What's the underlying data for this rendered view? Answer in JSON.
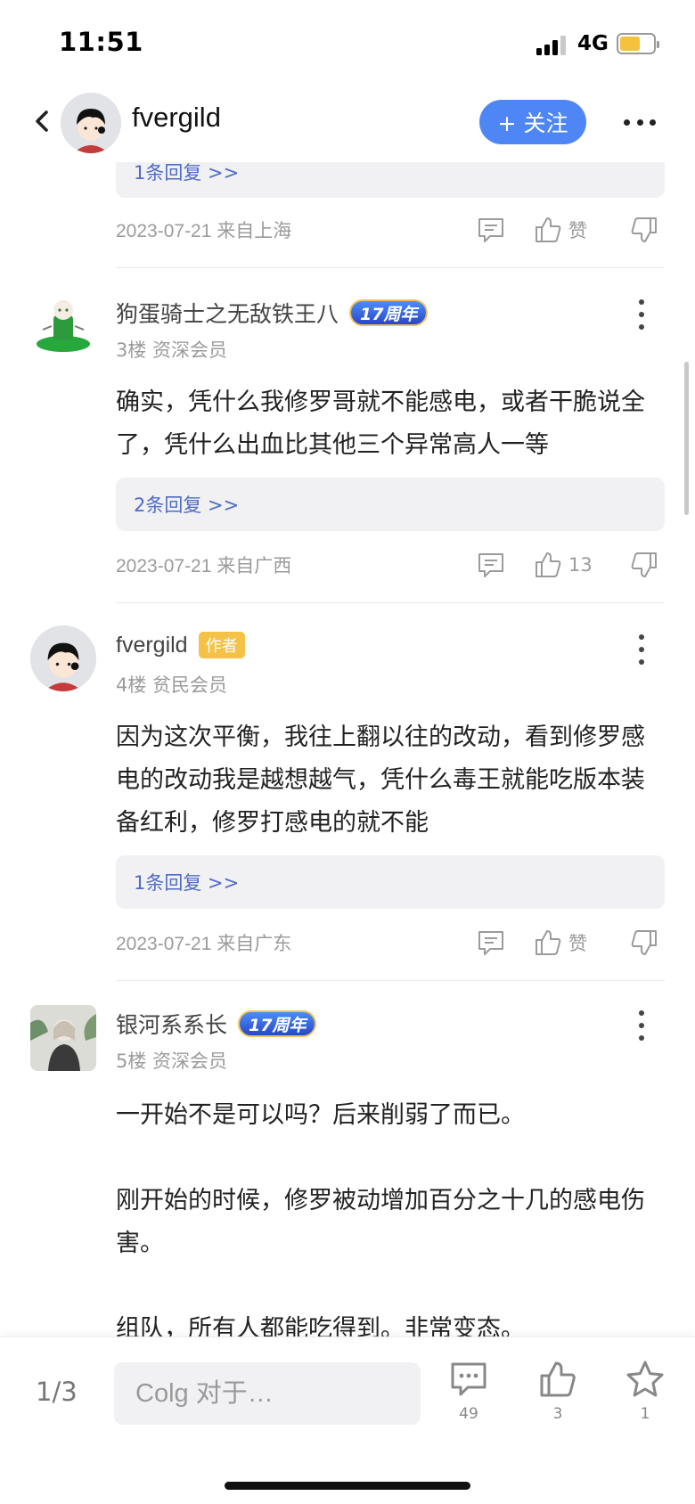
{
  "status_bar": {
    "time": "11:51",
    "network": "4G"
  },
  "header": {
    "username": "fvergild",
    "follow_label": "+ 关注"
  },
  "top_partial": {
    "reply_label": "1条回复 >>",
    "meta": "2023-07-21 来自上海",
    "like_label": "赞"
  },
  "comments": [
    {
      "username": "狗蛋骑士之无敌铁王八",
      "badge": "17周年",
      "floor": "3楼 资深会员",
      "content": "确实，凭什么我修罗哥就不能感电，或者干脆说全了，凭什么出血比其他三个异常高人一等",
      "reply_label": "2条回复 >>",
      "meta": "2023-07-21 来自广西",
      "like_label": "13"
    },
    {
      "username": "fvergild",
      "badge": "作者",
      "floor": "4楼 贫民会员",
      "content": "因为这次平衡，我往上翻以往的改动，看到修罗感电的改动我是越想越气，凭什么毒王就能吃版本装备红利，修罗打感电的就不能",
      "reply_label": "1条回复 >>",
      "meta": "2023-07-21 来自广东",
      "like_label": "赞"
    },
    {
      "username": "银河系系长",
      "badge": "17周年",
      "floor": "5楼 资深会员",
      "paragraphs": [
        "一开始不是可以吗？后来削弱了而已。",
        "刚开始的时候，修罗被动增加百分之十几的感电伤害。",
        "组队，所有人都能吃得到。非常变态。"
      ]
    }
  ],
  "bottom_bar": {
    "page": "1/3",
    "input_placeholder": "Colg 对于…",
    "comment_count": "49",
    "like_count": "3",
    "favorite_count": "1"
  },
  "icons": [
    "back-icon",
    "more-icon",
    "comment-icon",
    "like-icon",
    "dislike-icon",
    "star-icon"
  ],
  "colors": {
    "accent": "#4e86f5",
    "reply_link": "#4f6bc5",
    "badge_gold": "#f5c146"
  }
}
